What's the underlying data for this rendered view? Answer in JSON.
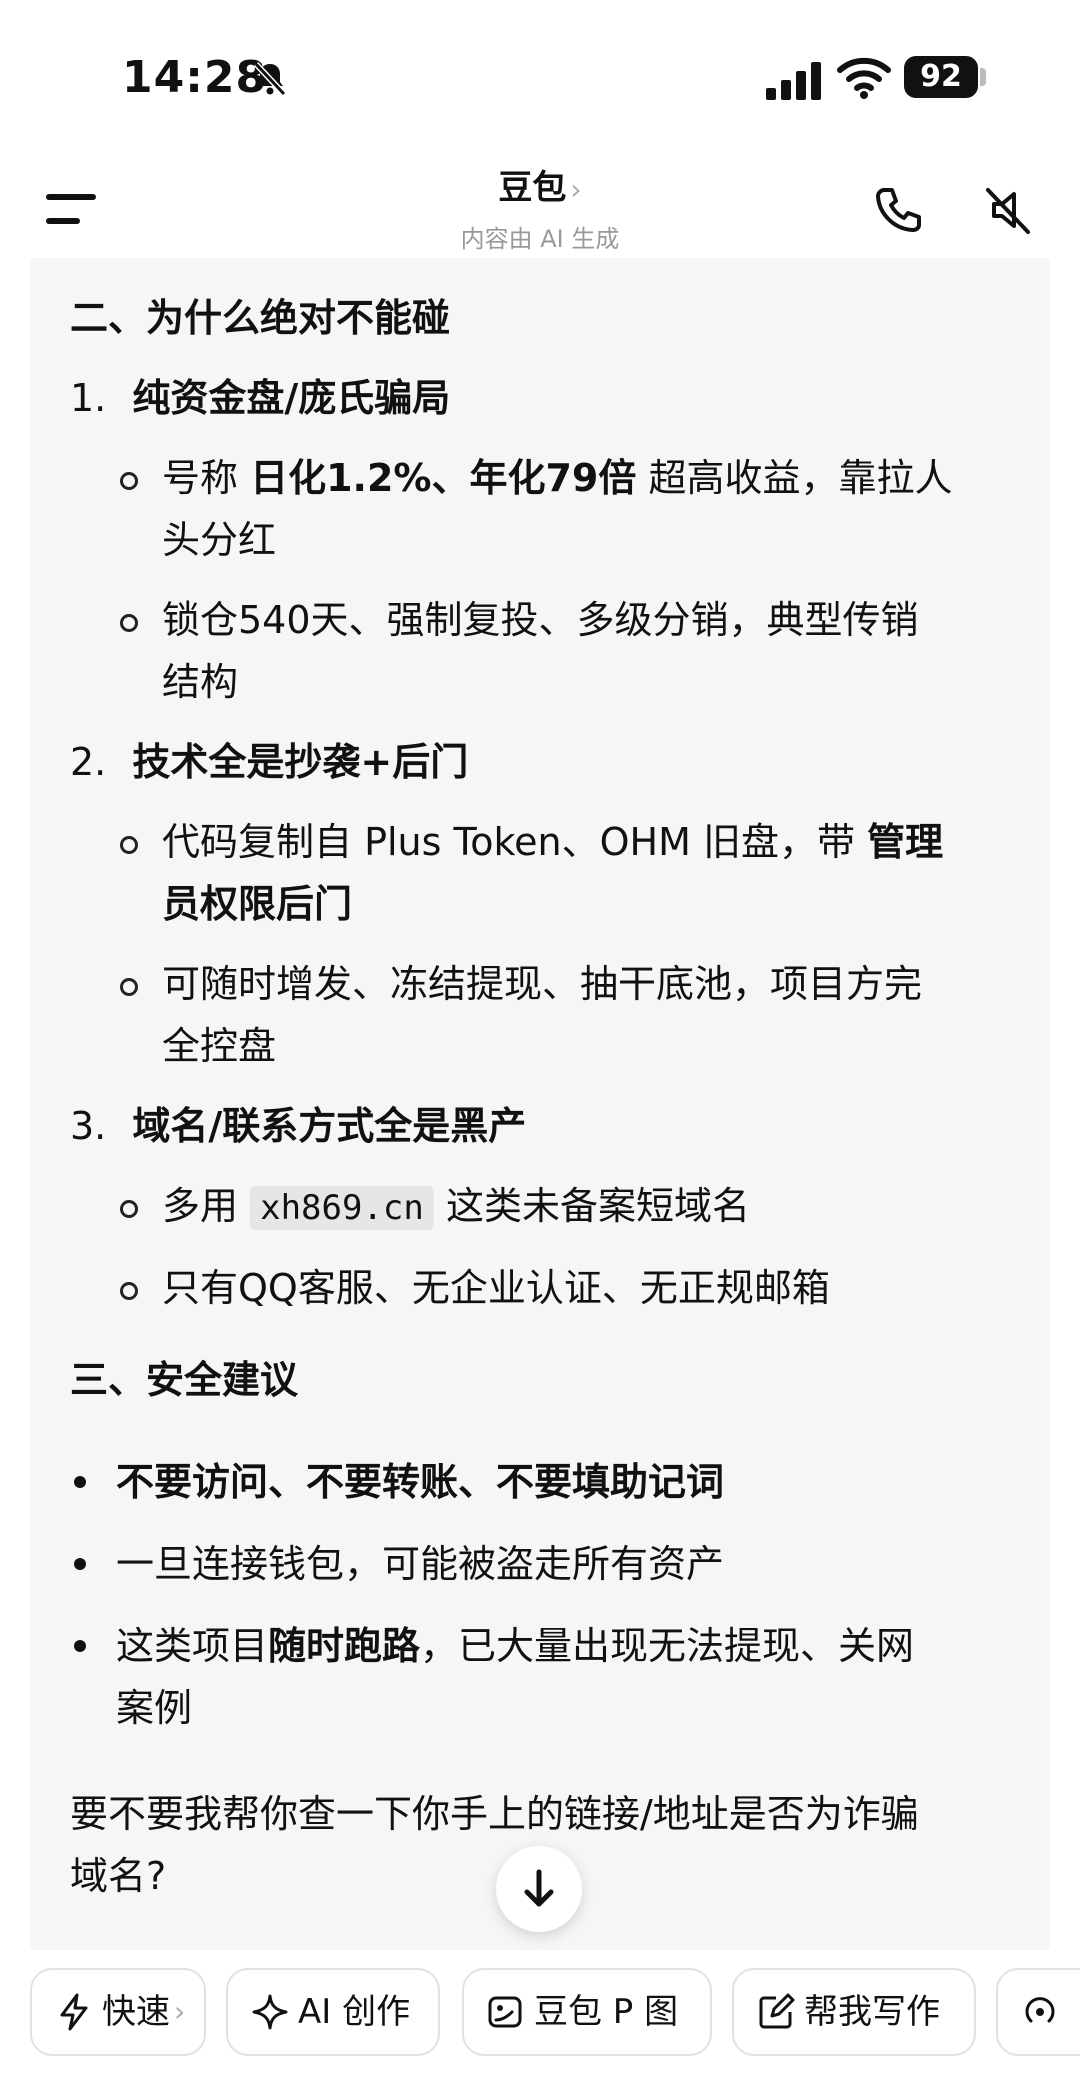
{
  "status_bar": {
    "time": "14:28",
    "battery": "92"
  },
  "header": {
    "title": "豆包",
    "title_chevron": "›",
    "subtitle": "内容由 AI 生成"
  },
  "message": {
    "section2_title": "二、为什么绝对不能碰",
    "items": [
      {
        "num": "1.",
        "title": "纯资金盘/庞氏骗局",
        "bullets": [
          [
            "号称 ",
            "日化1.2%、年化79倍",
            " 超高收益，靠拉人"
          ],
          [
            "头分红"
          ],
          [
            "锁仓540天、强制复投、多级分销，典型传销"
          ],
          [
            "结构"
          ]
        ]
      },
      {
        "num": "2.",
        "title": "技术全是抄袭+后门",
        "bullets": [
          [
            "代码复制自 Plus Token、OHM 旧盘，带 ",
            "管理"
          ],
          [
            "员权限后门"
          ],
          [
            "可随时增发、冻结提现、抽干底池，项目方完"
          ],
          [
            "全控盘"
          ]
        ]
      },
      {
        "num": "3.",
        "title": "域名/联系方式全是黑产",
        "bullets": [
          [
            "多用 ",
            "xh869.cn",
            " 这类未备案短域名"
          ],
          [
            "只有QQ客服、无企业认证、无正规邮箱"
          ]
        ]
      }
    ],
    "section3_title": "三、安全建议",
    "advice": [
      [
        "不要访问、不要转账、不要填助记词"
      ],
      [
        "一旦连接钱包，可能被盗走所有资产"
      ],
      [
        "这类项目",
        "随时跑路",
        "，已大量出现无法提现、关网"
      ],
      [
        "案例"
      ]
    ],
    "question_line1": "要不要我帮你查一下你手上的链接/地址是否为诈骗",
    "question_line2": "域名?"
  },
  "toolbar": {
    "chips": [
      "快速",
      "AI 创作",
      "豆包 P 图",
      "帮我写作",
      ""
    ],
    "quick_chevron": "›"
  }
}
